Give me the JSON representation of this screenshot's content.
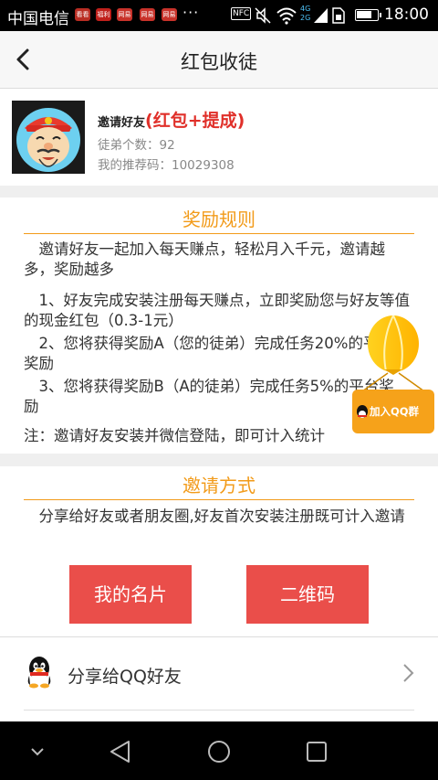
{
  "status_bar": {
    "carrier": "中国电信",
    "notif_icons": [
      "看看",
      "福利",
      "网易",
      "网易",
      "网易"
    ],
    "overflow": "···",
    "nfc": "NFC",
    "network": "4G 2G",
    "time": "18:00",
    "battery_level": 0.75
  },
  "header": {
    "title": "红包收徒"
  },
  "profile": {
    "invite_prefix": "邀请好友",
    "invite_highlight": "(红包+提成)",
    "apprentice_count": "徒弟个数：92",
    "referral_code": "我的推荐码：10029308"
  },
  "rules": {
    "title": "奖励规则",
    "intro": "　邀请好友一起加入每天赚点，轻松月入千元，邀请越多，奖励越多",
    "rule1": "　1、好友完成安装注册每天赚点，立即奖励您与好友等值的现金红包（0.3-1元）",
    "rule2": "　2、您将获得奖励A（您的徒弟）完成任务20%的平台奖励",
    "rule3": "　3、您将获得奖励B（A的徒弟）完成任务5%的平台奖励",
    "note": "注：邀请好友安装并微信登陆，即可计入统计"
  },
  "invite": {
    "title": "邀请方式",
    "description": "　分享给好友或者朋友圈,好友首次安装注册既可计入邀请",
    "card_button": "我的名片",
    "qrcode_button": "二维码"
  },
  "share": {
    "qq_label": "分享给QQ好友"
  },
  "floating": {
    "qq_group_label": "加入QQ群"
  },
  "colors": {
    "accent": "#f29b1a",
    "button": "#ea4e4a",
    "highlight": "#e0302a"
  }
}
